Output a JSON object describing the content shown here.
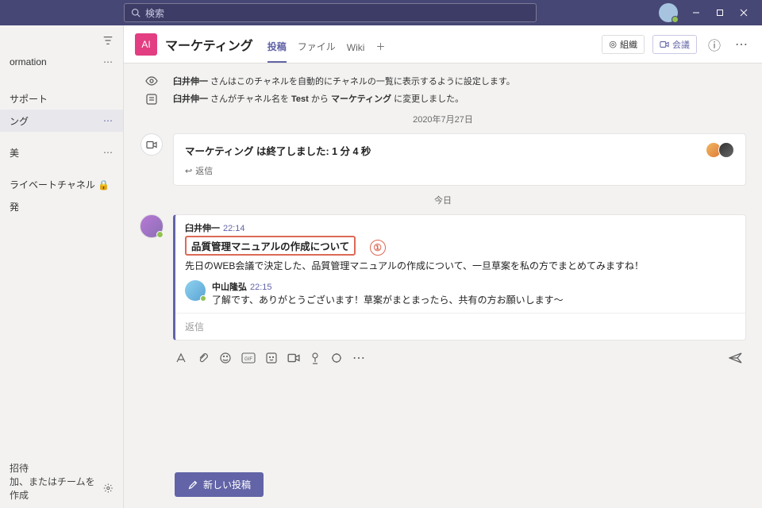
{
  "titlebar": {
    "search_placeholder": "検索"
  },
  "sidebar": {
    "items": [
      {
        "label": "ormation",
        "more": true
      },
      {
        "label": "サポート"
      },
      {
        "label": "ング",
        "active": true,
        "more": true
      },
      {
        "label": "美",
        "more": true
      },
      {
        "label": "ライベートチャネル 🔒"
      },
      {
        "label": "発"
      }
    ],
    "invite": "招待",
    "create_team": "加、またはチームを作成"
  },
  "header": {
    "tile": "AI",
    "title": "マーケティング",
    "tabs": [
      {
        "label": "投稿",
        "active": true
      },
      {
        "label": "ファイル"
      },
      {
        "label": "Wiki"
      }
    ],
    "org_btn": "組織",
    "meet_btn": "会議"
  },
  "feed": {
    "sys1_name": "臼井伸一",
    "sys1_text": " さんはこのチャネルを自動的にチャネルの一覧に表示するように設定します。",
    "sys2_name": "臼井伸一",
    "sys2_text_a": " さんがチャネル名を ",
    "sys2_from": "Test",
    "sys2_text_b": " から ",
    "sys2_to": "マーケティング",
    "sys2_text_c": " に変更しました。",
    "date1": "2020年7月27日",
    "meeting_line": "マーケティング は終了しました: 1 分 4 秒",
    "reply_label": "返信",
    "date2": "今日",
    "conv": {
      "author": "臼井伸一",
      "time": "22:14",
      "subject": "品質管理マニュアルの作成について",
      "annot": "①",
      "body": "先日のWEB会議で決定した、品質管理マニュアルの作成について、一旦草案を私の方でまとめてみますね！",
      "reply_author": "中山隆弘",
      "reply_time": "22:15",
      "reply_body": "了解です、ありがとうございます！草案がまとまったら、共有の方お願いします〜",
      "reply_placeholder": "返信"
    },
    "new_post": "新しい投稿"
  }
}
